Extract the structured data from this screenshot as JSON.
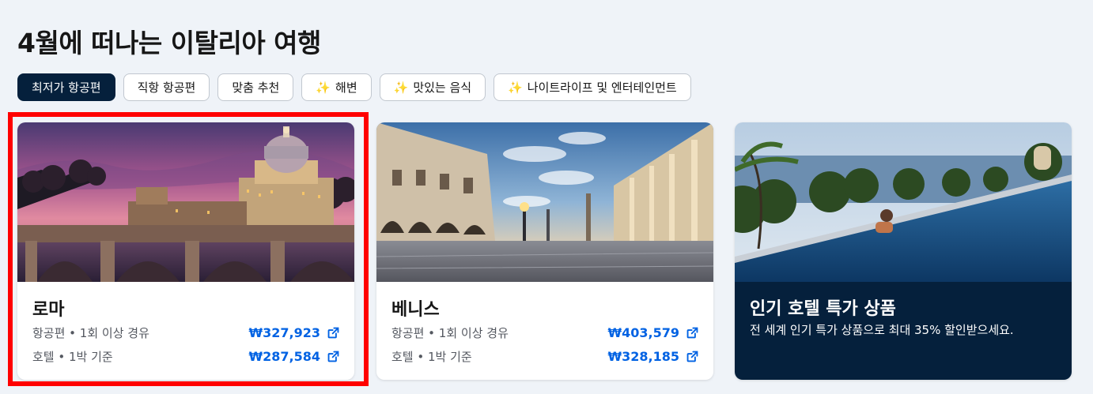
{
  "page_title": "4월에 떠나는 이탈리아 여행",
  "filters": [
    {
      "label": "최저가 항공편",
      "active": true,
      "sparkle": false
    },
    {
      "label": "직항 항공편",
      "active": false,
      "sparkle": false
    },
    {
      "label": "맞춤 추천",
      "active": false,
      "sparkle": false
    },
    {
      "label": "해변",
      "active": false,
      "sparkle": true
    },
    {
      "label": "맛있는 음식",
      "active": false,
      "sparkle": true
    },
    {
      "label": "나이트라이프 및 엔터테인먼트",
      "active": false,
      "sparkle": true
    }
  ],
  "sparkle_glyph": "✨",
  "cards": [
    {
      "city": "로마",
      "flight_label": "항공편",
      "flight_detail": "1회 이상 경유",
      "flight_price": "₩327,923",
      "hotel_label": "호텔",
      "hotel_detail": "1박 기준",
      "hotel_price": "₩287,584",
      "highlighted": true
    },
    {
      "city": "베니스",
      "flight_label": "항공편",
      "flight_detail": "1회 이상 경유",
      "flight_price": "₩403,579",
      "hotel_label": "호텔",
      "hotel_detail": "1박 기준",
      "hotel_price": "₩328,185",
      "highlighted": false
    }
  ],
  "promo": {
    "title": "인기 호텔 특가 상품",
    "subtitle": "전 세계 인기 특가 상품으로 최대 35% 할인받으세요."
  },
  "separator": " • ",
  "colors": {
    "accent": "#0062e3",
    "dark": "#05203c",
    "highlight": "#ff0000",
    "background": "#eff3f8"
  }
}
